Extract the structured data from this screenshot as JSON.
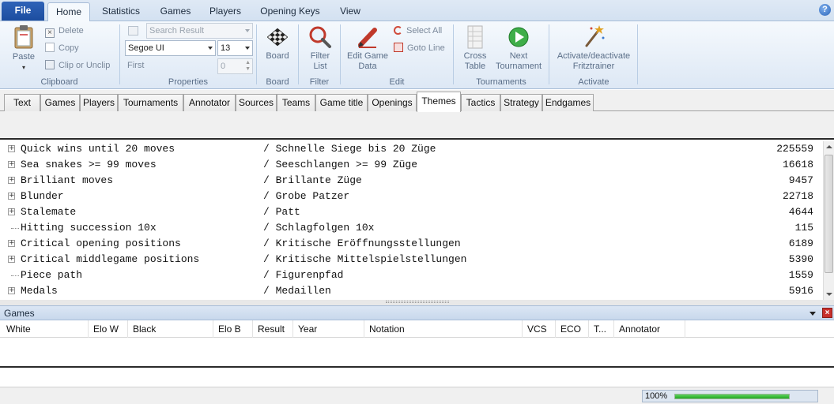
{
  "ribbon": {
    "file_label": "File",
    "tabs": [
      {
        "label": "Home",
        "active": true
      },
      {
        "label": "Statistics",
        "active": false
      },
      {
        "label": "Games",
        "active": false
      },
      {
        "label": "Players",
        "active": false
      },
      {
        "label": "Opening Keys",
        "active": false
      },
      {
        "label": "View",
        "active": false
      }
    ],
    "help_label": "?"
  },
  "clipboard": {
    "paste_label": "Paste",
    "delete_label": "Delete",
    "copy_label": "Copy",
    "clip_label": "Clip or Unclip",
    "group_label": "Clipboard"
  },
  "properties": {
    "search_placeholder": "Search Result",
    "font_value": "Segoe UI",
    "size_value": "13",
    "first_label": "First",
    "first_value": "0",
    "group_label": "Properties"
  },
  "board": {
    "button_label": "Board",
    "group_label": "Board"
  },
  "filter": {
    "button_label": "Filter List",
    "group_label": "Filter"
  },
  "edit": {
    "edit_game_data_label": "Edit Game Data",
    "select_all_label": "Select All",
    "goto_line_label": "Goto Line",
    "group_label": "Edit"
  },
  "tournaments": {
    "cross_table_label": "Cross Table",
    "next_tournament_label": "Next Tournament",
    "group_label": "Tournaments"
  },
  "activate": {
    "button_label": "Activate/deactivate Fritztrainer",
    "group_label": "Activate"
  },
  "category_tabs": [
    {
      "label": "Text",
      "active": false
    },
    {
      "label": "Games",
      "active": false
    },
    {
      "label": "Players",
      "active": false
    },
    {
      "label": "Tournaments",
      "active": false
    },
    {
      "label": "Annotator",
      "active": false
    },
    {
      "label": "Sources",
      "active": false
    },
    {
      "label": "Teams",
      "active": false
    },
    {
      "label": "Game title",
      "active": false
    },
    {
      "label": "Openings",
      "active": false
    },
    {
      "label": "Themes",
      "active": true
    },
    {
      "label": "Tactics",
      "active": false
    },
    {
      "label": "Strategy",
      "active": false
    },
    {
      "label": "Endgames",
      "active": false
    }
  ],
  "themes": [
    {
      "en": "Quick wins until 20 moves",
      "de": "/ Schnelle Siege bis 20 Züge",
      "count": "225559",
      "expandable": true
    },
    {
      "en": "Sea snakes >= 99 moves",
      "de": "/ Seeschlangen >= 99 Züge",
      "count": "16618",
      "expandable": true
    },
    {
      "en": "Brilliant moves",
      "de": "/ Brillante Züge",
      "count": "9457",
      "expandable": true
    },
    {
      "en": "Blunder",
      "de": "/ Grobe Patzer",
      "count": "22718",
      "expandable": true
    },
    {
      "en": "Stalemate",
      "de": "/ Patt",
      "count": "4644",
      "expandable": true
    },
    {
      "en": "Hitting succession 10x",
      "de": "/ Schlagfolgen 10x",
      "count": "115",
      "expandable": false
    },
    {
      "en": "Critical opening positions",
      "de": "/ Kritische Eröffnungsstellungen",
      "count": "6189",
      "expandable": true
    },
    {
      "en": "Critical middlegame positions",
      "de": "/ Kritische Mittelspielstellungen",
      "count": "5390",
      "expandable": true
    },
    {
      "en": "Piece path",
      "de": "/ Figurenpfad",
      "count": "1559",
      "expandable": false
    },
    {
      "en": "Medals",
      "de": "/ Medaillen",
      "count": "5916",
      "expandable": true
    }
  ],
  "games_panel": {
    "title": "Games",
    "columns": [
      "White",
      "Elo W",
      "Black",
      "Elo B",
      "Result",
      "Year",
      "Notation",
      "VCS",
      "ECO",
      "T...",
      "Annotator"
    ]
  },
  "status": {
    "progress_text": "100%",
    "progress_value": 100
  }
}
